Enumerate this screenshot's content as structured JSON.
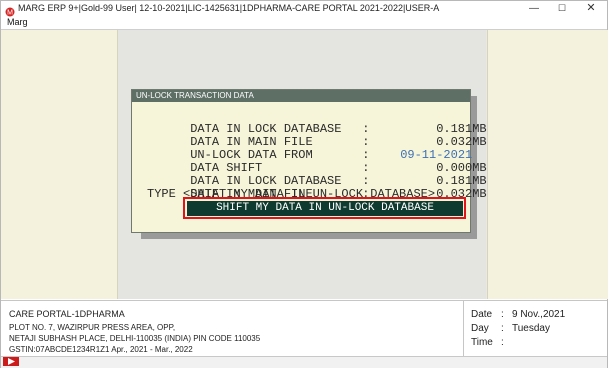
{
  "window": {
    "title": "MARG ERP 9+|Gold-99 User| 12-10-2021|LIC-1425631|1DPHARMA-CARE PORTAL 2021-2022|USER-A",
    "minimize_label": "—",
    "maximize_label": "☐",
    "close_label": "✕"
  },
  "menubar": {
    "items": [
      "Marg"
    ]
  },
  "dialog": {
    "title": "UN-LOCK TRANSACTION DATA",
    "rows": [
      {
        "label": "DATA IN LOCK DATABASE",
        "colon": ":",
        "value": "0.181",
        "unit": "MB"
      },
      {
        "label": "DATA IN MAIN FILE",
        "colon": ":",
        "value": "0.032",
        "unit": "MB"
      },
      {
        "label": "UN-LOCK DATA FROM",
        "colon": ":",
        "value": "09-11-2021",
        "unit": ""
      },
      {
        "label": "DATA SHIFT",
        "colon": ":",
        "value": "0.000",
        "unit": "MB"
      },
      {
        "label": "DATA IN LOCK DATABASE",
        "colon": ":",
        "value": "0.181",
        "unit": "MB"
      },
      {
        "label": "DATA IN MAIN FILE",
        "colon": ":",
        "value": "0.032",
        "unit": "MB"
      }
    ],
    "type_line": "TYPE <SHIFT MY DATA IN UN-LOCK DATABASE>",
    "input_value": "SHIFT MY DATA IN UN-LOCK DATABASE",
    "highlight_color": "#e0141a"
  },
  "footer": {
    "company": "CARE PORTAL-1DPHARMA",
    "address1": "PLOT NO. 7, WAZIRPUR PRESS AREA, OPP,",
    "address2": "NETAJI SUBHASH PLACE, DELHI-110035 (INDIA) PIN CODE 110035",
    "gstin": "GSTIN:07ABCDE1234R1Z1  Apr., 2021 - Mar., 2022",
    "date_label": "Date",
    "date_sep": ":",
    "date_value": "9 Nov.,2021",
    "day_label": "Day",
    "day_sep": ":",
    "day_value": "Tuesday",
    "time_label": "Time",
    "time_sep": ":",
    "time_value": ""
  },
  "icons": {
    "app": "marg-logo-icon",
    "play": "play-icon"
  }
}
